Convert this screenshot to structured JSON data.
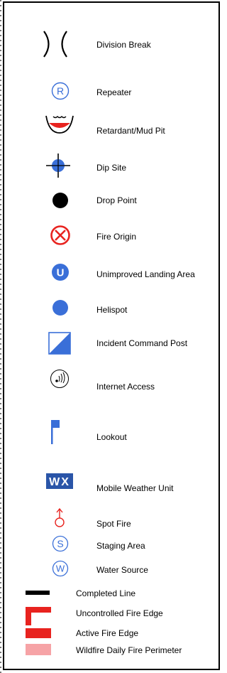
{
  "colors": {
    "blue": "#3a6fd8",
    "red": "#e8231f",
    "black": "#000000",
    "pink": "#f6a3a6"
  },
  "legend": {
    "items": [
      {
        "icon": "division-break-icon",
        "label": "Division Break"
      },
      {
        "icon": "repeater-icon",
        "label": "Repeater"
      },
      {
        "icon": "retardant-mud-pit-icon",
        "label": "Retardant/Mud Pit"
      },
      {
        "icon": "dip-site-icon",
        "label": "Dip Site"
      },
      {
        "icon": "drop-point-icon",
        "label": "Drop Point"
      },
      {
        "icon": "fire-origin-icon",
        "label": "Fire Origin"
      },
      {
        "icon": "unimproved-landing-area-icon",
        "label": "Unimproved Landing Area"
      },
      {
        "icon": "helispot-icon",
        "label": "Helispot"
      },
      {
        "icon": "incident-command-post-icon",
        "label": "Incident Command Post"
      },
      {
        "icon": "internet-access-icon",
        "label": "Internet Access"
      },
      {
        "icon": "lookout-icon",
        "label": "Lookout"
      },
      {
        "icon": "mobile-weather-unit-icon",
        "label": "Mobile Weather Unit"
      },
      {
        "icon": "spot-fire-icon",
        "label": "Spot Fire"
      },
      {
        "icon": "staging-area-icon",
        "label": "Staging Area"
      },
      {
        "icon": "water-source-icon",
        "label": "Water Source"
      },
      {
        "icon": "completed-line-icon",
        "label": "Completed Line"
      },
      {
        "icon": "uncontrolled-fire-edge-icon",
        "label": "Uncontrolled Fire Edge"
      },
      {
        "icon": "active-fire-edge-icon",
        "label": "Active Fire Edge"
      },
      {
        "icon": "wildfire-daily-fire-perimeter-icon",
        "label": "Wildfire Daily Fire Perimeter"
      }
    ],
    "glyphs": {
      "repeater": "R",
      "unimproved_landing_area": "U",
      "mobile_weather_unit": "WX",
      "staging_area": "S",
      "water_source": "W"
    }
  }
}
